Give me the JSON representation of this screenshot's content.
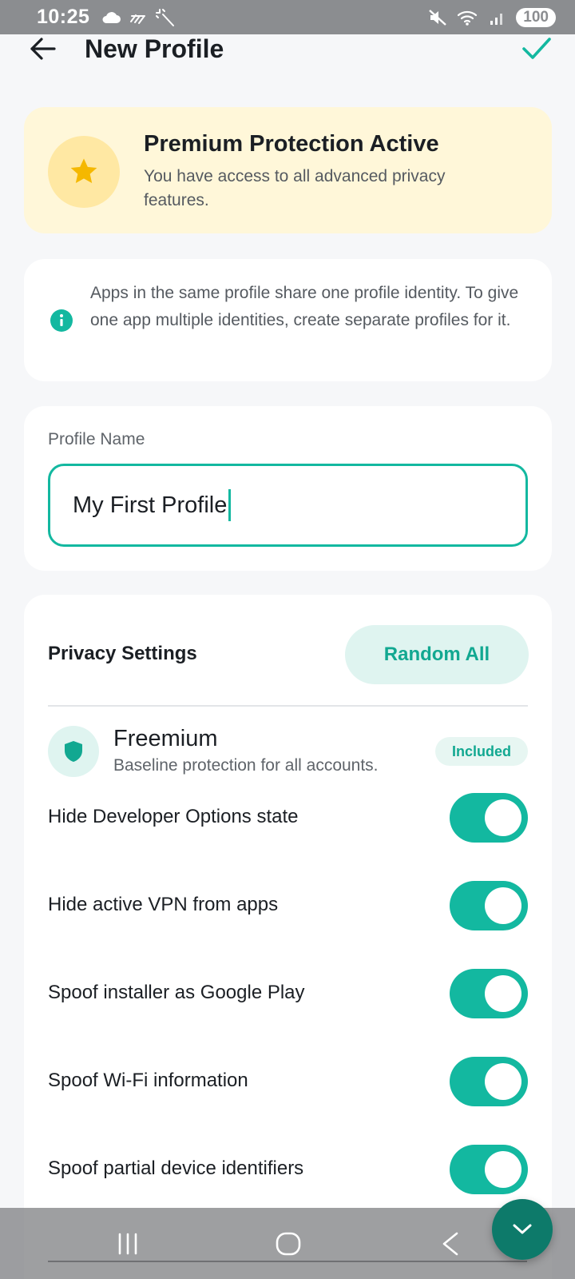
{
  "status_bar": {
    "time": "10:25",
    "battery": "100",
    "icons": [
      "cloud-icon",
      "wind-icon",
      "magic-wand-icon",
      "mute-icon",
      "wifi-icon",
      "signal-icon"
    ]
  },
  "app_bar": {
    "title": "New Profile",
    "back_icon": "arrow-left-icon",
    "save_icon": "check-icon"
  },
  "premium_banner": {
    "title": "Premium Protection Active",
    "description": "You have access to all advanced privacy features.",
    "icon": "star-icon"
  },
  "info_card": {
    "text": "Apps in the same profile share one profile identity. To give one app multiple identities, create separate profiles for it.",
    "icon": "info-icon"
  },
  "profile_name": {
    "label": "Profile Name",
    "value": "My First Profile"
  },
  "privacy_settings": {
    "title": "Privacy Settings",
    "random_all_label": "Random All",
    "tier": {
      "name": "Freemium",
      "description": "Baseline protection for all accounts.",
      "badge": "Included",
      "icon": "shield-icon"
    },
    "toggles": [
      {
        "label": "Hide Developer Options state",
        "enabled": true
      },
      {
        "label": "Hide active VPN from apps",
        "enabled": true
      },
      {
        "label": "Spoof installer as Google Play",
        "enabled": true
      },
      {
        "label": "Spoof Wi-Fi information",
        "enabled": true
      },
      {
        "label": "Spoof partial device identifiers",
        "enabled": true
      }
    ]
  },
  "colors": {
    "accent": "#13b8a0",
    "accent_dark": "#0d7a6a",
    "premium_bg": "#fff7d9",
    "star": "#f5b800"
  }
}
